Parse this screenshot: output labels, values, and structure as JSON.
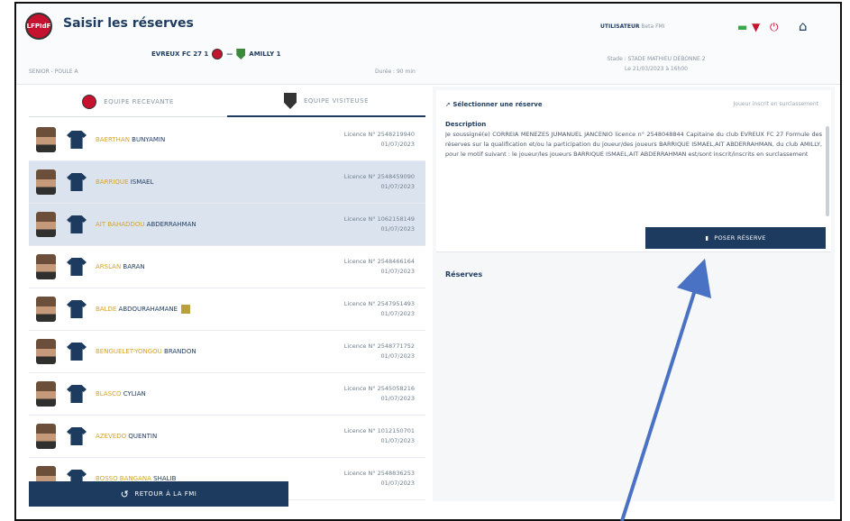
{
  "header": {
    "logo_text": "LFPIdF",
    "title": "Saisir les réserves",
    "home_team": "EVREUX FC 27 1",
    "away_team": "AMILLY 1",
    "division": "SENIOR - POULE A",
    "duree": "Durée : 90 min",
    "user_label": "UTILISATEUR",
    "user_name": "Beta FMI",
    "stade": "Stade : STADE MATHIEU DEBONNE 2",
    "datetime": "Le 21/03/2023 à 16h00"
  },
  "tabs": [
    {
      "label": "EQUIPE RECEVANTE"
    },
    {
      "label": "EQUIPE VISITEUSE"
    }
  ],
  "players": [
    {
      "last": "BAERTHAN",
      "first": "BUNYAMIN",
      "licence": "Licence N° 2548219940",
      "date": "01/07/2023",
      "selected": false,
      "badge": false
    },
    {
      "last": "BARRIQUE",
      "first": "ISMAEL",
      "licence": "Licence N° 2548459090",
      "date": "01/07/2023",
      "selected": true,
      "badge": false
    },
    {
      "last": "AIT BAHADDOU",
      "first": "ABDERRAHMAN",
      "licence": "Licence N° 1062158149",
      "date": "01/07/2023",
      "selected": true,
      "badge": false
    },
    {
      "last": "ARSLAN",
      "first": "BARAN",
      "licence": "Licence N° 2548466164",
      "date": "01/07/2023",
      "selected": false,
      "badge": false
    },
    {
      "last": "BALDE",
      "first": "ABDOURAHAMANE",
      "licence": "Licence N° 2547951493",
      "date": "01/07/2023",
      "selected": false,
      "badge": true
    },
    {
      "last": "BENGUELET-YONGOU",
      "first": "BRANDON",
      "licence": "Licence N° 2548771752",
      "date": "01/07/2023",
      "selected": false,
      "badge": false
    },
    {
      "last": "BLASCO",
      "first": "CYLIAN",
      "licence": "Licence N° 2545058216",
      "date": "01/07/2023",
      "selected": false,
      "badge": false
    },
    {
      "last": "AZEVEDO",
      "first": "QUENTIN",
      "licence": "Licence N° 1012150701",
      "date": "01/07/2023",
      "selected": false,
      "badge": false
    },
    {
      "last": "BOSSO BANGANA",
      "first": "SHALIB",
      "licence": "Licence N° 2548836253",
      "date": "01/07/2023",
      "selected": false,
      "badge": false
    }
  ],
  "retour_label": "RETOUR À LA FMI",
  "reserve_panel": {
    "select_title": "Sélectionner une réserve",
    "select_right": "Joueur inscrit en surclassement",
    "description_label": "Description",
    "description_text": "Je soussigné(e) CORREIA MENEZES JUMANUEL JANCENIO licence n° 2548048844 Capitaine du club EVREUX FC 27 Formule des réserves sur la qualification et/ou la participation du joueur/des joueurs BARRIQUE ISMAEL,AIT ABDERRAHMAN, du club AMILLY, pour le motif suivant : le joueur/les joueurs BARRIQUE ISMAEL,AIT ABDERRAHMAN est/sont inscrit/inscrits en surclassement",
    "poser_label": "POSER RÉSERVE",
    "reserves_title": "Réserves"
  },
  "colors": {
    "primary": "#1d3a5f",
    "accent_name": "#d4a52a",
    "selected_row": "#dbe4ee",
    "arrow": "#4a72c4"
  }
}
